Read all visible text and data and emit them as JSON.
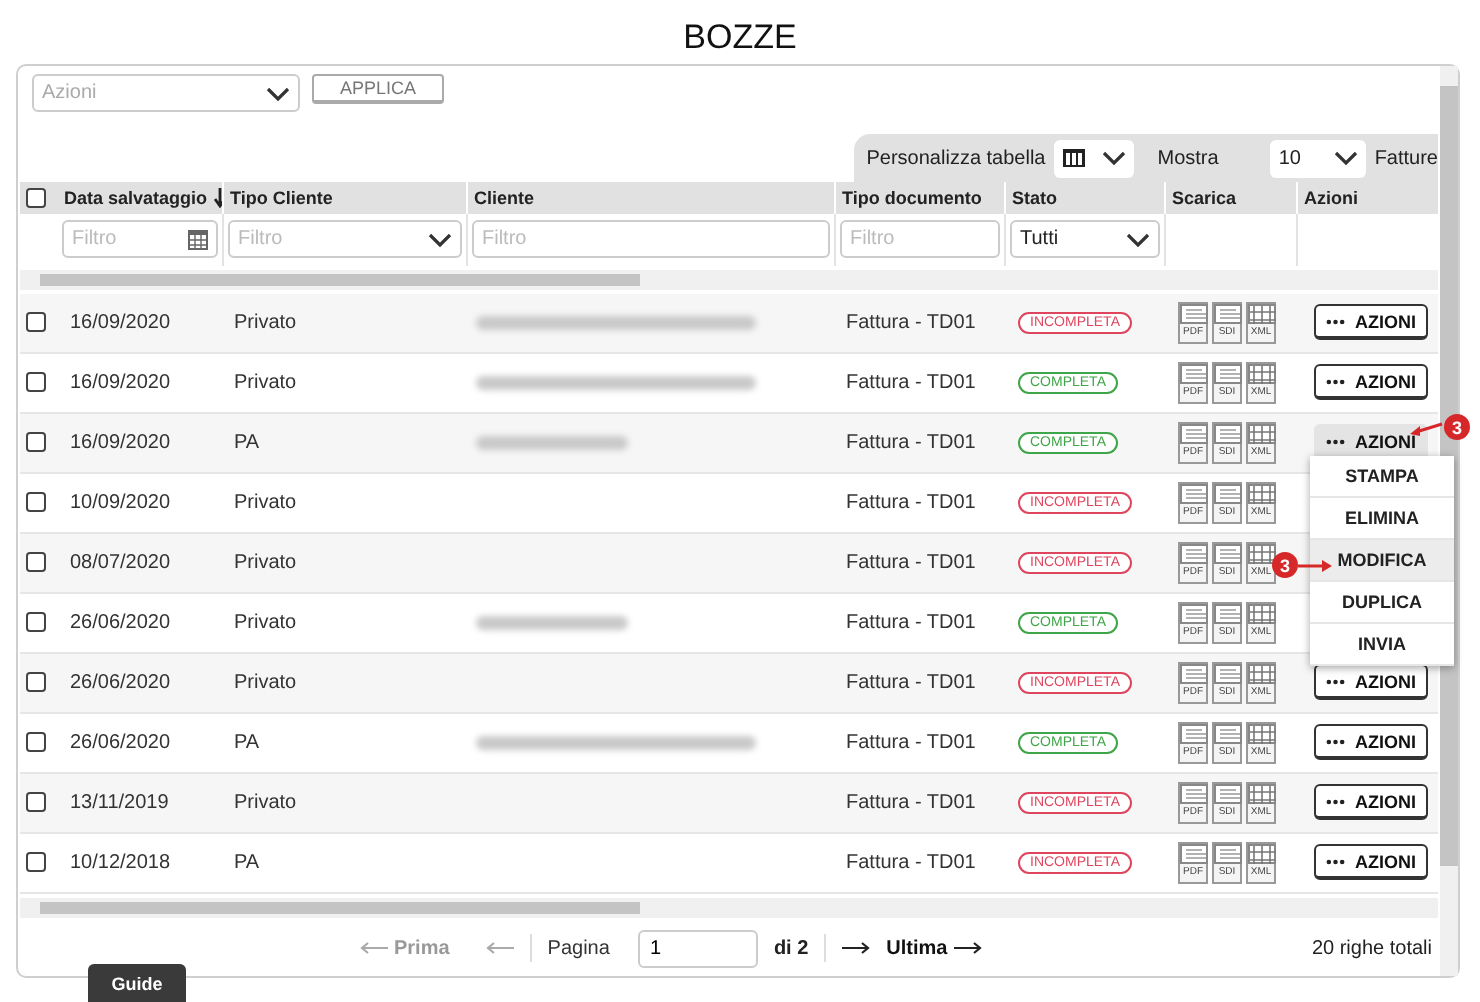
{
  "title": "BOZZE",
  "toolbar": {
    "actions_select": {
      "placeholder": "Azioni"
    },
    "apply_button": "APPLICA"
  },
  "table_settings": {
    "customize_label": "Personalizza tabella",
    "show_label": "Mostra",
    "page_size": "10",
    "page_size_unit": "Fatture"
  },
  "columns": [
    {
      "label": "Data salvataggio",
      "sorted": true,
      "filter": {
        "kind": "date",
        "placeholder": "Filtro"
      }
    },
    {
      "label": "Tipo Cliente",
      "filter": {
        "kind": "select",
        "placeholder": "Filtro"
      }
    },
    {
      "label": "Cliente",
      "filter": {
        "kind": "text",
        "placeholder": "Filtro"
      }
    },
    {
      "label": "Tipo documento",
      "filter": {
        "kind": "text",
        "placeholder": "Filtro"
      }
    },
    {
      "label": "Stato",
      "filter": {
        "kind": "select",
        "value": "Tutti"
      }
    },
    {
      "label": "Scarica"
    },
    {
      "label": "Azioni"
    }
  ],
  "rows": [
    {
      "checked": false,
      "date": "16/09/2020",
      "client_type": "Privato",
      "client_redacted": true,
      "doc_type": "Fattura - TD01",
      "status": {
        "label": "INCOMPLETA",
        "color": "#e0455e"
      },
      "downloads": [
        "PDF",
        "SDI",
        "XML"
      ],
      "action": "AZIONI",
      "menu_open": false
    },
    {
      "checked": false,
      "date": "16/09/2020",
      "client_type": "Privato",
      "client_redacted": true,
      "doc_type": "Fattura - TD01",
      "status": {
        "label": "COMPLETA",
        "color": "#3ea548"
      },
      "downloads": [
        "PDF",
        "SDI",
        "XML"
      ],
      "action": "AZIONI",
      "menu_open": false
    },
    {
      "checked": false,
      "date": "16/09/2020",
      "client_type": "PA",
      "client_redacted": true,
      "doc_type": "Fattura - TD01",
      "status": {
        "label": "COMPLETA",
        "color": "#3ea548"
      },
      "downloads": [
        "PDF",
        "SDI",
        "XML"
      ],
      "action": "AZIONI",
      "menu_open": true
    },
    {
      "checked": false,
      "date": "10/09/2020",
      "client_type": "Privato",
      "doc_type": "Fattura - TD01",
      "status": {
        "label": "INCOMPLETA",
        "color": "#e0455e"
      },
      "downloads": [
        "PDF",
        "SDI",
        "XML"
      ]
    },
    {
      "checked": false,
      "date": "08/07/2020",
      "client_type": "Privato",
      "doc_type": "Fattura - TD01",
      "status": {
        "label": "INCOMPLETA",
        "color": "#e0455e"
      },
      "downloads": [
        "PDF",
        "SDI",
        "XML"
      ]
    },
    {
      "checked": false,
      "date": "26/06/2020",
      "client_type": "Privato",
      "client_redacted": true,
      "doc_type": "Fattura - TD01",
      "status": {
        "label": "COMPLETA",
        "color": "#3ea548"
      },
      "downloads": [
        "PDF",
        "SDI",
        "XML"
      ]
    },
    {
      "checked": false,
      "date": "26/06/2020",
      "client_type": "Privato",
      "doc_type": "Fattura - TD01",
      "status": {
        "label": "INCOMPLETA",
        "color": "#e0455e"
      },
      "downloads": [
        "PDF",
        "SDI",
        "XML"
      ],
      "action": "AZIONI",
      "menu_open": false
    },
    {
      "checked": false,
      "date": "26/06/2020",
      "client_type": "PA",
      "client_redacted": true,
      "doc_type": "Fattura - TD01",
      "status": {
        "label": "COMPLETA",
        "color": "#3ea548"
      },
      "downloads": [
        "PDF",
        "SDI",
        "XML"
      ],
      "action": "AZIONI",
      "menu_open": false
    },
    {
      "checked": false,
      "date": "13/11/2019",
      "client_type": "Privato",
      "doc_type": "Fattura - TD01",
      "status": {
        "label": "INCOMPLETA",
        "color": "#e0455e"
      },
      "downloads": [
        "PDF",
        "SDI",
        "XML"
      ],
      "action": "AZIONI",
      "menu_open": false
    },
    {
      "checked": false,
      "date": "10/12/2018",
      "client_type": "PA",
      "doc_type": "Fattura - TD01",
      "status": {
        "label": "INCOMPLETA",
        "color": "#e0455e"
      },
      "downloads": [
        "PDF",
        "SDI",
        "XML"
      ],
      "action": "AZIONI",
      "menu_open": false
    }
  ],
  "select_all": {
    "checked": false
  },
  "action_menu": [
    {
      "label": "STAMPA",
      "selected": false
    },
    {
      "label": "ELIMINA",
      "selected": false
    },
    {
      "label": "MODIFICA",
      "selected": true
    },
    {
      "label": "DUPLICA",
      "selected": false
    },
    {
      "label": "INVIA",
      "selected": false
    }
  ],
  "annotations": [
    {
      "label": "3"
    },
    {
      "label": "3"
    }
  ],
  "pagination": {
    "first": "Prima",
    "page_label": "Pagina",
    "page": "1",
    "of": "di 2",
    "last": "Ultima",
    "total": "20 righe totali"
  },
  "guide_tab": "Guide"
}
